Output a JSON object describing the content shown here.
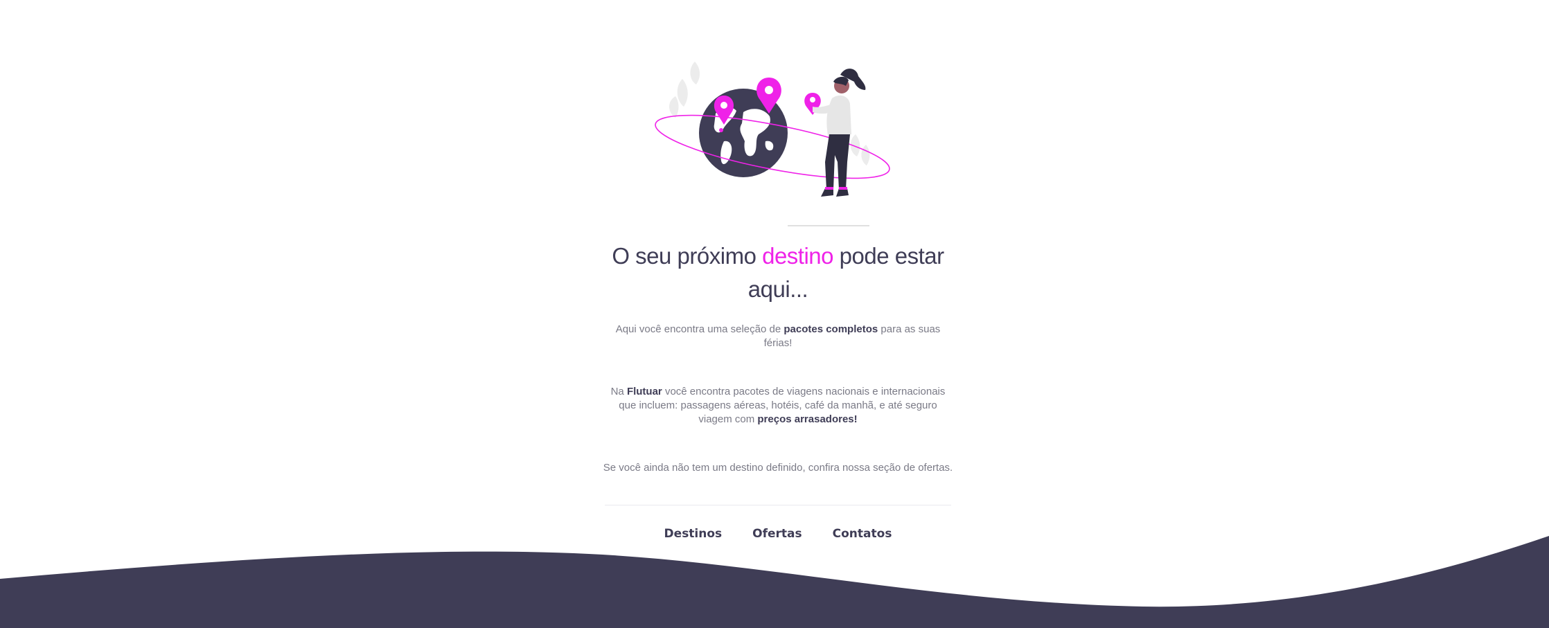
{
  "colors": {
    "accent": "#ef22e8",
    "dark": "#3f3d56",
    "text_muted": "#7a7a86",
    "background": "#ffffff"
  },
  "hero": {
    "illustration": "woman-placing-pins-on-globe",
    "title_before": "O seu próximo ",
    "title_accent": "destino",
    "title_after": " pode estar aqui..."
  },
  "intro": {
    "p1_before": "Aqui você encontra uma seleção de ",
    "p1_bold": "pacotes completos",
    "p1_after": " para as suas férias!",
    "p2_before": "Na ",
    "p2_bold_brand": "Flutuar",
    "p2_middle": " você encontra pacotes de viagens nacionais e internacionais que incluem: passagens aéreas, hotéis, café da manhã, e até seguro viagem com ",
    "p2_bold_end": "preços arrasadores!",
    "p3": "Se você ainda não tem um destino definido, confira nossa seção de ofertas."
  },
  "nav": {
    "destinos": "Destinos",
    "ofertas": "Ofertas",
    "contatos": "Contatos"
  }
}
